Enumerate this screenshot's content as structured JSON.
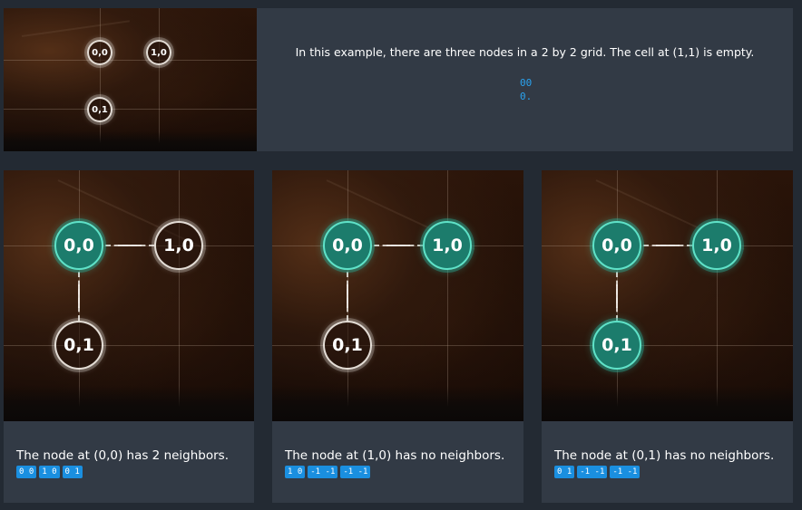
{
  "intro": {
    "text": "In this example, there are three nodes in a 2 by 2 grid. The cell at (1,1) is empty.",
    "grid_lines": [
      "00",
      "0."
    ],
    "nodes": [
      "0,0",
      "1,0",
      "0,1"
    ]
  },
  "cards": [
    {
      "nodes": [
        {
          "label": "0,0",
          "style": "green"
        },
        {
          "label": "1,0",
          "style": "white"
        },
        {
          "label": "0,1",
          "style": "white"
        }
      ],
      "caption": "The node at (0,0) has 2 neighbors.",
      "chips": [
        "0 0",
        "1 0",
        "0 1"
      ]
    },
    {
      "nodes": [
        {
          "label": "0,0",
          "style": "green"
        },
        {
          "label": "1,0",
          "style": "green"
        },
        {
          "label": "0,1",
          "style": "white"
        }
      ],
      "caption": "The node at (1,0) has no neighbors.",
      "chips": [
        "1 0",
        "-1 -1",
        "-1 -1"
      ]
    },
    {
      "nodes": [
        {
          "label": "0,0",
          "style": "green"
        },
        {
          "label": "1,0",
          "style": "green"
        },
        {
          "label": "0,1",
          "style": "green"
        }
      ],
      "caption": "The node at (0,1) has no neighbors.",
      "chips": [
        "0 1",
        "-1 -1",
        "-1 -1"
      ]
    }
  ],
  "colors": {
    "background": "#232a33",
    "panel": "#323a45",
    "accent": "#2aa3ef",
    "chip": "#1a8fe0",
    "node_green": "#1c7c6c",
    "node_green_ring": "#5fe2c8"
  }
}
